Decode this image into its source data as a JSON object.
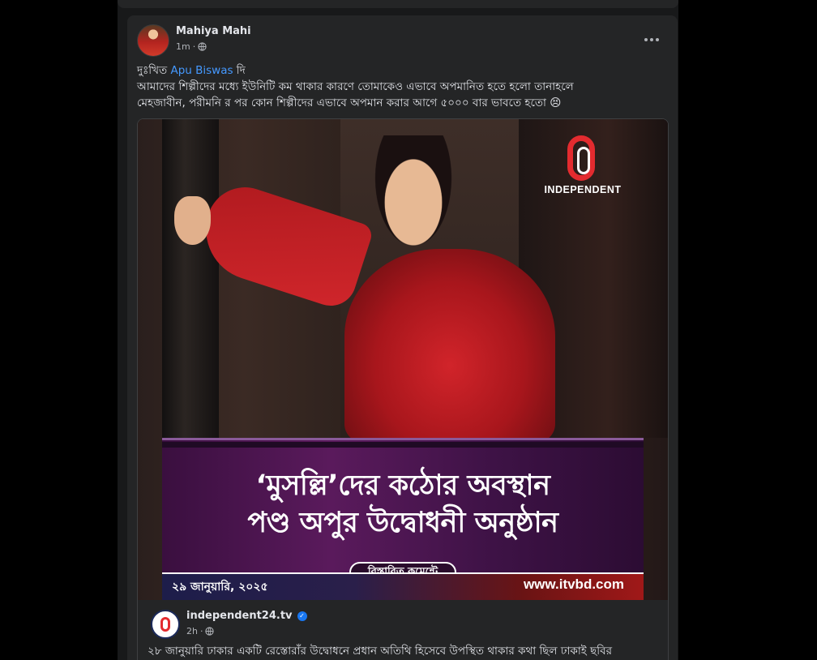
{
  "post": {
    "author": "Mahiya Mahi",
    "time": "1m",
    "dot": "·",
    "more_icon": "more-horizontal-icon",
    "text_line1_prefix": "দুঃখিত",
    "mention": "Apu Biswas",
    "text_line1_suffix": "দি",
    "text_line2": "আমাদের শিল্পীদের মধ্যে ইউনিটি কম থাকার কারণে তোমাকেও এভাবে অপমানিত হতে হলো তানাহলে",
    "text_line3": "মেহজাবীন, পরীমনি র পর কোন শিল্পীদের এভাবে অপমান করার আগে ৫০০০ বার ভাবতে হতো 😣"
  },
  "shared_image": {
    "logo_text": "INDEPENDENT",
    "headline1": "‘মুসল্লি’দের কঠোর অবস্থান",
    "headline2": "পণ্ড অপুর উদ্বোধনী অনুষ্ঠান",
    "pill": "বিস্তারিত কমেন্টে",
    "date": "২৯ জানুয়ারি, ২০২৫",
    "site": "www.itvbd.com"
  },
  "shared_source": {
    "name": "independent24.tv",
    "time": "2h",
    "dot": "·",
    "text": "২৮ জানুয়ারি ঢাকার একটি রেস্তোরাঁর উদ্বোধনে প্রধান অতিথি হিসেবে উপস্থিত থাকার কথা ছিল ঢাকাই ছবির"
  },
  "colors": {
    "background": "#000000",
    "card": "#242526",
    "mention": "#4599ff",
    "brand_red": "#e32b2f",
    "verified": "#1877f2"
  }
}
